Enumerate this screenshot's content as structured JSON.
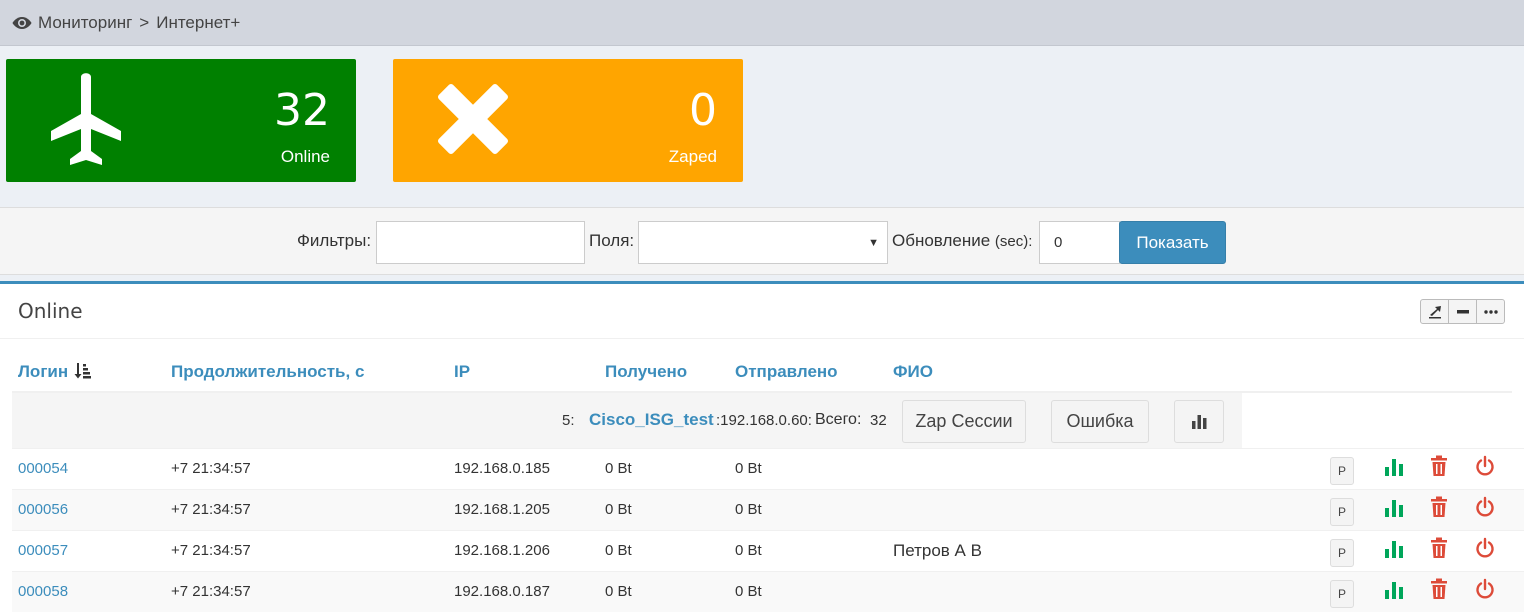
{
  "breadcrumb": {
    "section": "Мониторинг",
    "separator": ">",
    "page": "Интернет+"
  },
  "stats": {
    "online": {
      "value": "32",
      "label": "Online",
      "icon": "plane-icon",
      "color": "#008000"
    },
    "zaped": {
      "value": "0",
      "label": "Zaped",
      "icon": "close-icon",
      "color": "#ffa500"
    }
  },
  "filters": {
    "filters_label": "Фильтры:",
    "filters_value": "",
    "fields_label": "Поля:",
    "fields_selected": "",
    "refresh_label": "Обновление",
    "refresh_unit": "(sec):",
    "refresh_value": "0",
    "show_button": "Показать"
  },
  "box": {
    "title": "Online",
    "accent": "#3c8dbc"
  },
  "table": {
    "columns": [
      "Логин",
      "Продолжительность, с",
      "IP",
      "Получено",
      "Отправлено",
      "ФИО"
    ],
    "group": {
      "number": "5:",
      "nas": "Cisco_ISG_test",
      "ip": ":192.168.0.60:",
      "total_label": "Всего:",
      "total": "32",
      "zap_button": "Zap Сессии",
      "error_button": "Ошибка"
    },
    "rows": [
      {
        "login": "000054",
        "duration": "+7 21:34:57",
        "ip": "192.168.0.185",
        "received": "0 Bt",
        "sent": "0 Bt",
        "fio": ""
      },
      {
        "login": "000056",
        "duration": "+7 21:34:57",
        "ip": "192.168.1.205",
        "received": "0 Bt",
        "sent": "0 Bt",
        "fio": ""
      },
      {
        "login": "000057",
        "duration": "+7 21:34:57",
        "ip": "192.168.1.206",
        "received": "0 Bt",
        "sent": "0 Bt",
        "fio": "Петров А В"
      },
      {
        "login": "000058",
        "duration": "+7 21:34:57",
        "ip": "192.168.0.187",
        "received": "0 Bt",
        "sent": "0 Bt",
        "fio": ""
      }
    ],
    "row_button_label": "P"
  }
}
